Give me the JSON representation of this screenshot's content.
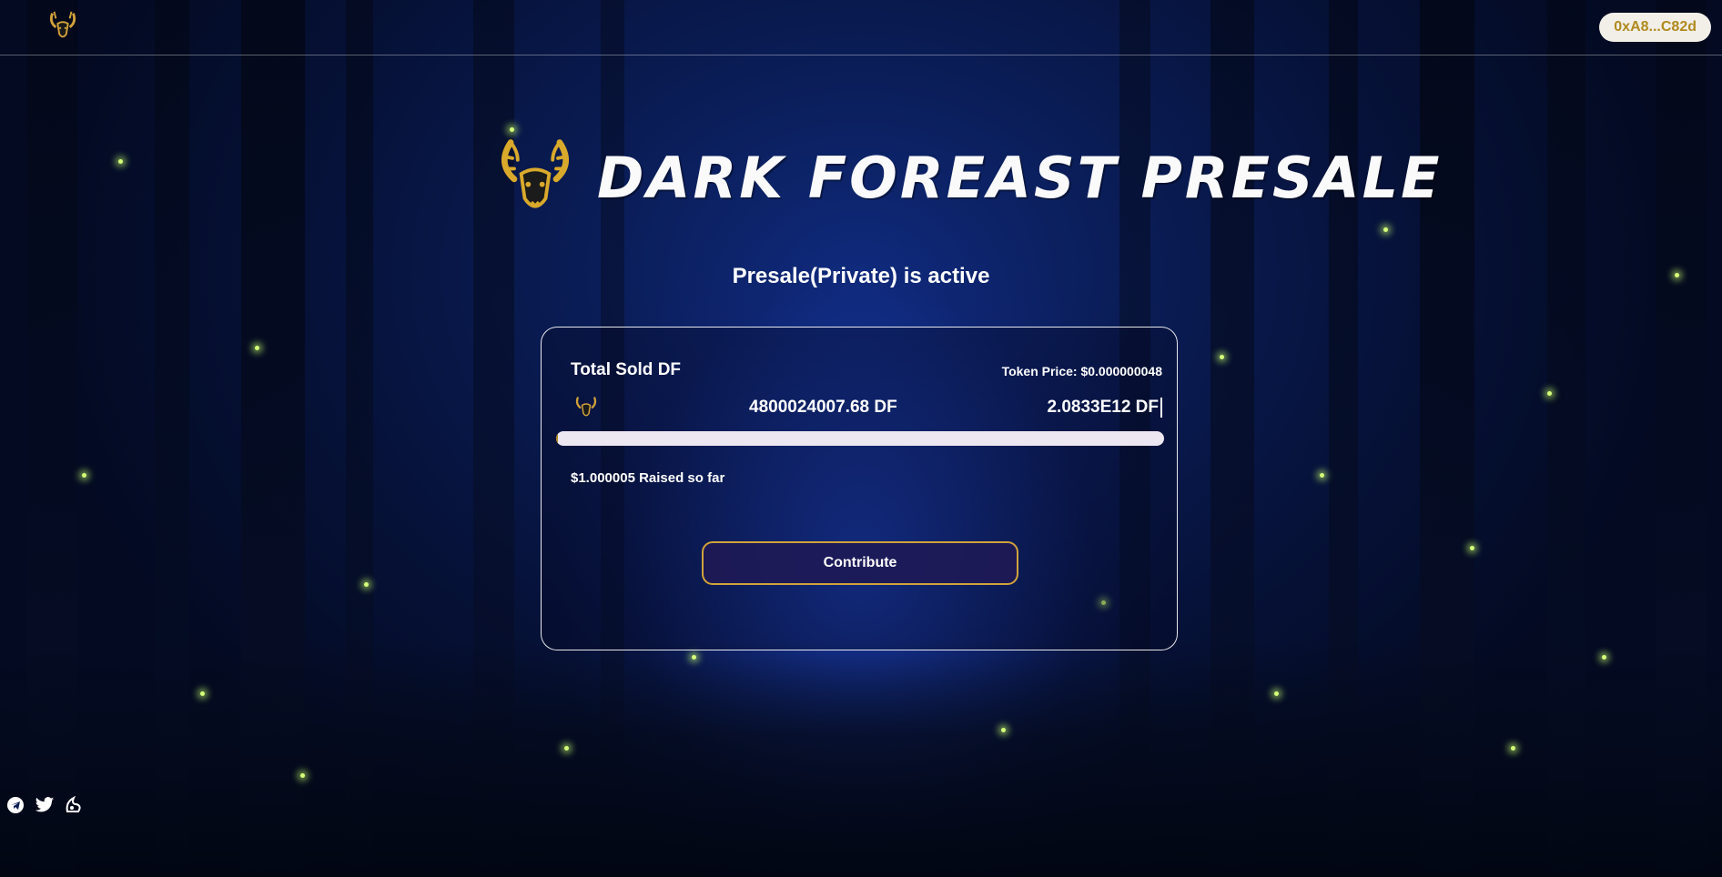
{
  "header": {
    "wallet_label": "0xA8...C82d"
  },
  "hero": {
    "title": "DARK FOREAST PRESALE"
  },
  "status": {
    "text": "Presale(Private) is active"
  },
  "card": {
    "sold_label": "Total Sold DF",
    "price_label": "Token Price: ",
    "price_value": "$0.000000048",
    "sold_amount": "4800024007.68 DF",
    "cap_amount": "2.0833E12 DF",
    "progress_fraction": 0.0023,
    "raised_amount": "$1.000005",
    "raised_suffix": " Raised so far",
    "contribute_label": "Contribute"
  },
  "social": {
    "icons": [
      "telegram-icon",
      "twitter-icon",
      "dextools-icon"
    ]
  },
  "colors": {
    "accent_gold": "#d2a23a",
    "wallet_text": "#b08a1e",
    "button_bg": "#1e1955",
    "progress_track": "#ece7f1"
  }
}
